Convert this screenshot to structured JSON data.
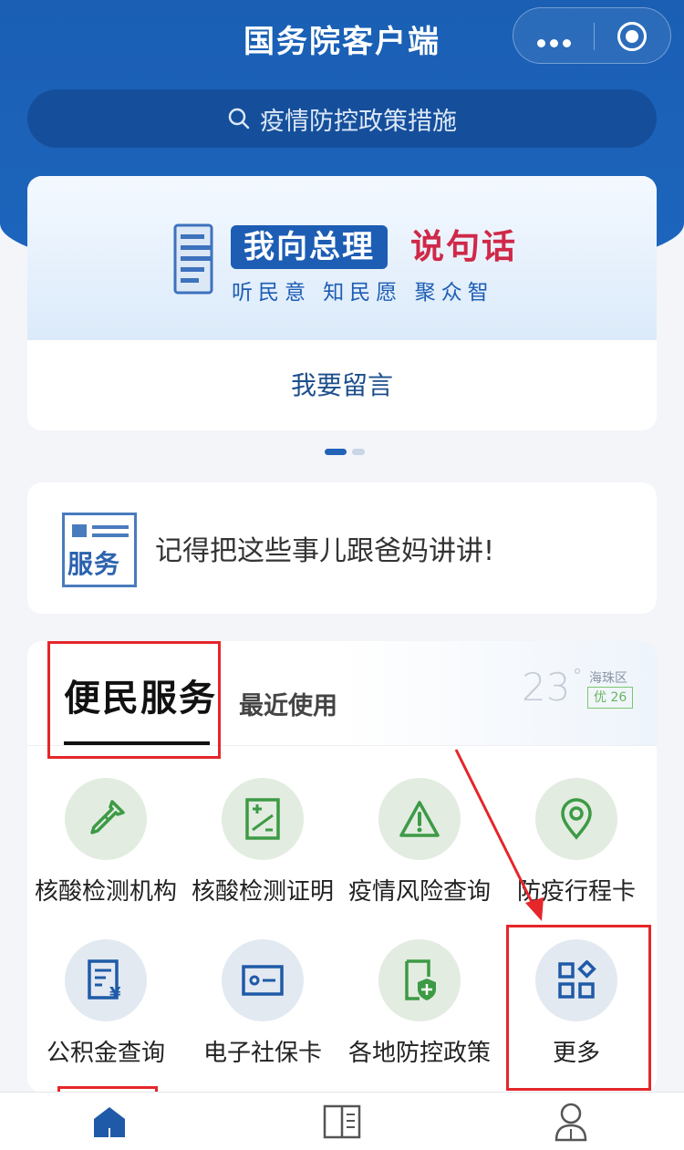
{
  "header": {
    "title": "国务院客户端",
    "search_placeholder": "疫情防控政策措施",
    "capsule": {
      "more_icon": "dots-icon",
      "close_icon": "target-icon"
    }
  },
  "banner": {
    "pill_text": "我向总理",
    "red_text": "说句话",
    "slogan": "听民意  知民愿  聚众智",
    "action": "我要留言",
    "page_indicator": {
      "total": 2,
      "active": 1
    }
  },
  "notice": {
    "badge_text": "服务",
    "message": "记得把这些事儿跟爸妈讲讲!"
  },
  "services": {
    "tabs": [
      {
        "label": "便民服务",
        "active": true
      },
      {
        "label": "最近使用",
        "active": false
      }
    ],
    "weather": {
      "temp": "23",
      "unit": "°",
      "location": "海珠区",
      "air_quality": "优 26"
    },
    "items": [
      {
        "label": "核酸检测机构",
        "icon": "dropper-icon",
        "tone": "green"
      },
      {
        "label": "核酸检测证明",
        "icon": "certificate-icon",
        "tone": "green"
      },
      {
        "label": "疫情风险查询",
        "icon": "warning-icon",
        "tone": "green"
      },
      {
        "label": "防疫行程卡",
        "icon": "location-pin-icon",
        "tone": "green"
      },
      {
        "label": "公积金查询",
        "icon": "fund-doc-icon",
        "tone": "blue"
      },
      {
        "label": "电子社保卡",
        "icon": "id-card-icon",
        "tone": "blue"
      },
      {
        "label": "各地防控政策",
        "icon": "shield-doc-icon",
        "tone": "green"
      },
      {
        "label": "更多",
        "icon": "grid-more-icon",
        "tone": "blue"
      }
    ]
  },
  "bottom_nav": [
    {
      "name": "home",
      "icon": "home-icon",
      "active": true
    },
    {
      "name": "reader",
      "icon": "book-icon",
      "active": false
    },
    {
      "name": "profile",
      "icon": "user-icon",
      "active": false
    }
  ],
  "colors": {
    "header_blue": "#1a5fb4",
    "accent_red": "#d02848",
    "annotation_red": "#e5262a",
    "icon_green": "#3d9a45",
    "icon_blue": "#1f5aa8"
  }
}
